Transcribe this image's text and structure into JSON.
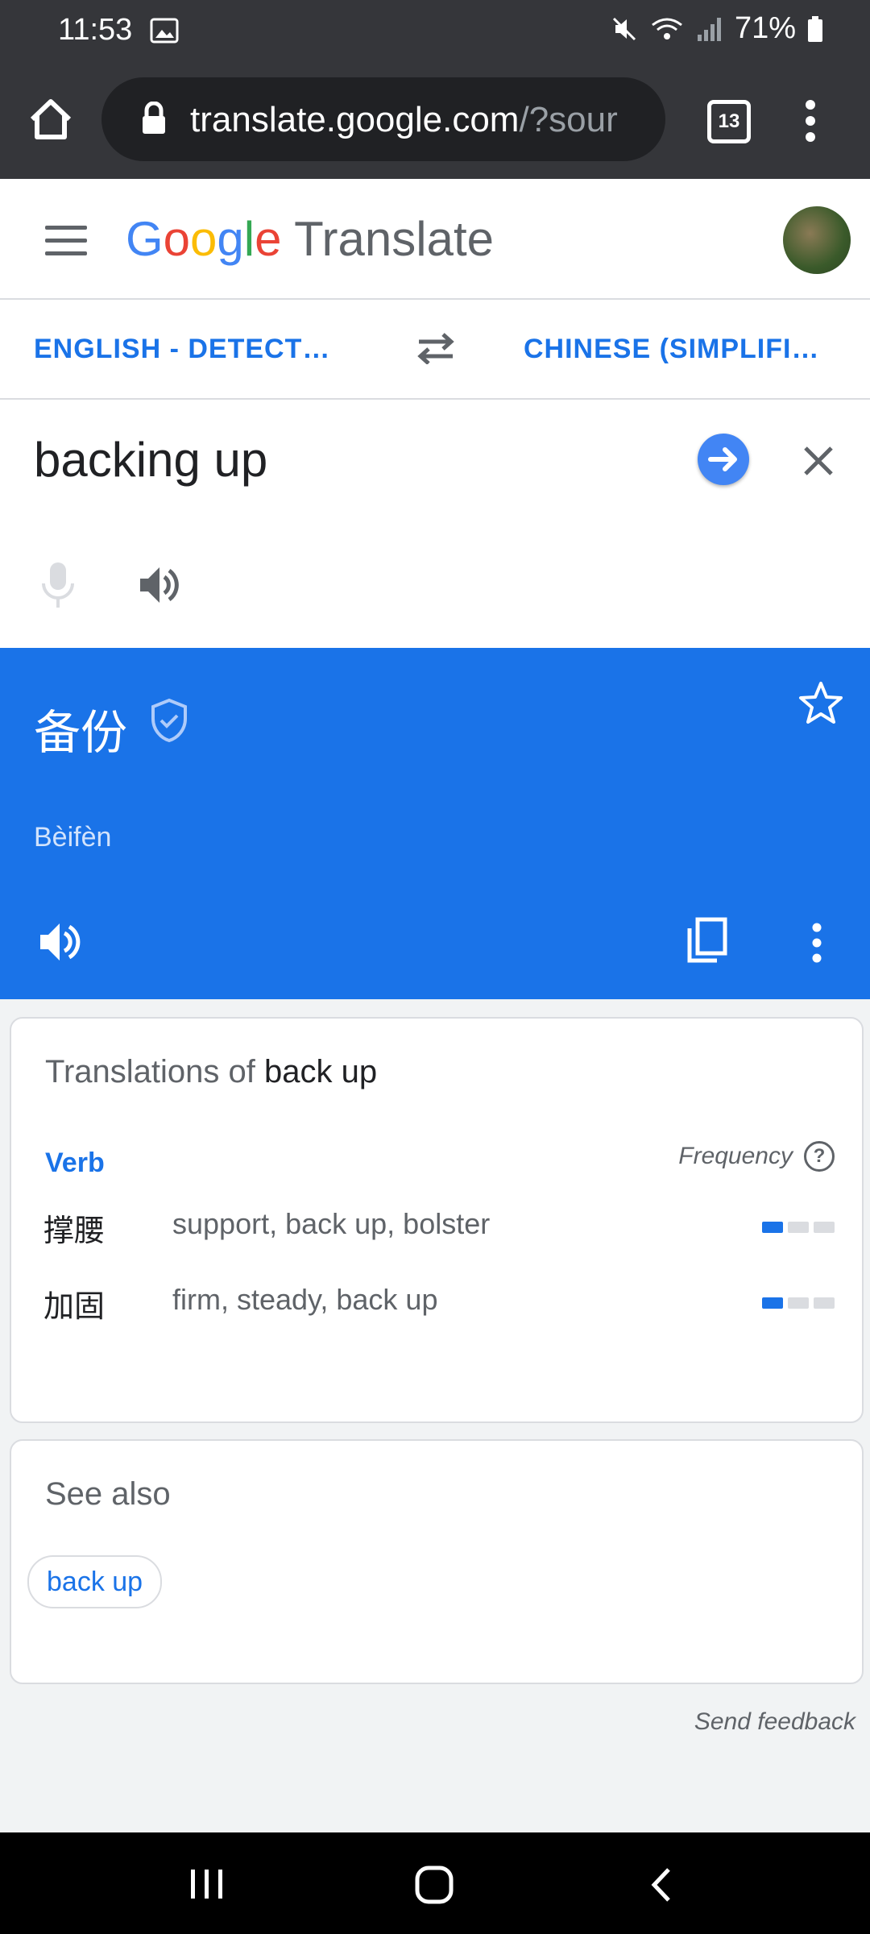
{
  "status_bar": {
    "time": "11:53",
    "battery": "71%"
  },
  "browser": {
    "url_main": "translate.google.com",
    "url_rest": "/?sour",
    "tab_count": "13"
  },
  "header": {
    "logo_letters": [
      "G",
      "o",
      "o",
      "g",
      "l",
      "e"
    ],
    "app_name": "Translate"
  },
  "languages": {
    "source": "ENGLISH - DETECT…",
    "target": "CHINESE (SIMPLIFI…"
  },
  "input": {
    "text": "backing up"
  },
  "result": {
    "translation": "备份",
    "romanization": "Bèifèn"
  },
  "translations_card": {
    "title_prefix": "Translations of",
    "title_term": "back up",
    "part_of_speech": "Verb",
    "frequency_label": "Frequency",
    "help_glyph": "?",
    "rows": [
      {
        "word": "撑腰",
        "synonyms": "support, back up, bolster",
        "frequency_level": 1
      },
      {
        "word": "加固",
        "synonyms": "firm, steady, back up",
        "frequency_level": 1
      }
    ]
  },
  "see_also": {
    "title": "See also",
    "chips": [
      "back up"
    ]
  },
  "footer": {
    "feedback": "Send feedback"
  },
  "colors": {
    "accent": "#1a73e8",
    "chrome": "#35363a",
    "background": "#f1f3f4"
  },
  "icons": [
    "image-icon",
    "mute-icon",
    "wifi-icon",
    "signal-icon",
    "battery-icon",
    "home-icon",
    "lock-icon",
    "more-vert-icon",
    "hamburger-menu-icon",
    "swap-icon",
    "arrow-forward-icon",
    "close-icon",
    "microphone-icon",
    "speaker-icon",
    "verified-shield-icon",
    "star-icon",
    "copy-icon",
    "recents-icon",
    "home-nav-icon",
    "back-nav-icon"
  ]
}
